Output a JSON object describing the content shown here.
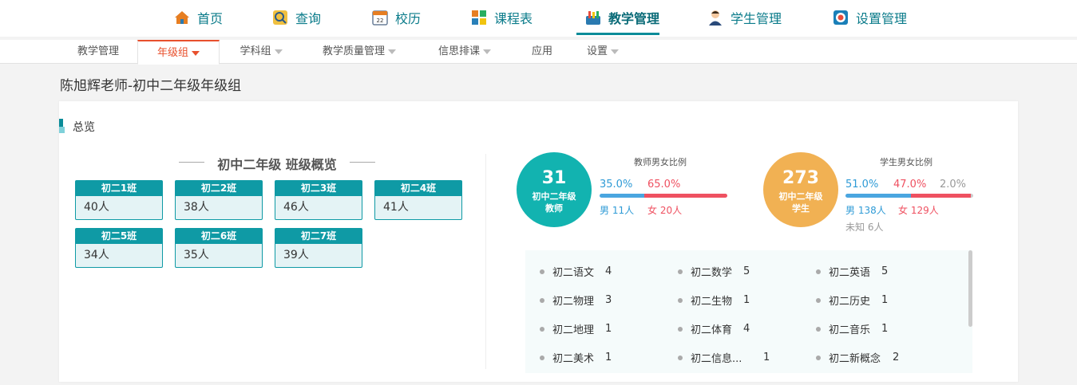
{
  "topnav": {
    "items": [
      {
        "label": "首页",
        "icon": "home-icon"
      },
      {
        "label": "查询",
        "icon": "search-icon"
      },
      {
        "label": "校历",
        "icon": "calendar-icon"
      },
      {
        "label": "课程表",
        "icon": "timetable-icon"
      },
      {
        "label": "教学管理",
        "icon": "teaching-icon",
        "active": true
      },
      {
        "label": "学生管理",
        "icon": "student-icon"
      },
      {
        "label": "设置管理",
        "icon": "settings-icon"
      }
    ]
  },
  "subnav": {
    "items": [
      {
        "label": "教学管理"
      },
      {
        "label": "年级组",
        "active": true
      },
      {
        "label": "学科组"
      },
      {
        "label": "教学质量管理"
      },
      {
        "label": "信思排课"
      },
      {
        "label": "应用"
      },
      {
        "label": "设置"
      }
    ]
  },
  "page": {
    "title": "陈旭辉老师-初中二年级年级组"
  },
  "overview": {
    "heading": "总览",
    "section_title": "初中二年级  班级概览",
    "classes": [
      {
        "name": "初二1班",
        "count": "40人"
      },
      {
        "name": "初二2班",
        "count": "38人"
      },
      {
        "name": "初二3班",
        "count": "46人"
      },
      {
        "name": "初二4班",
        "count": "41人"
      },
      {
        "name": "初二5班",
        "count": "34人"
      },
      {
        "name": "初二6班",
        "count": "35人"
      },
      {
        "name": "初二7班",
        "count": "39人"
      }
    ]
  },
  "teachers": {
    "total": "31",
    "label_line1": "初中二年级",
    "label_line2": "教师",
    "ratio_title": "教师男女比例",
    "male_pct": "35.0%",
    "female_pct": "65.0%",
    "male_count": "男 11人",
    "female_count": "女 20人",
    "male_fraction": 0.35,
    "female_fraction": 0.65
  },
  "students": {
    "total": "273",
    "label_line1": "初中二年级",
    "label_line2": "学生",
    "ratio_title": "学生男女比例",
    "male_pct": "51.0%",
    "female_pct": "47.0%",
    "unknown_pct": "2.0%",
    "male_count": "男 138人",
    "female_count": "女 129人",
    "unknown_count": "未知 6人",
    "male_fraction": 0.51,
    "female_fraction": 0.47,
    "unknown_fraction": 0.02
  },
  "subjects": [
    {
      "name": "初二语文",
      "count": "4"
    },
    {
      "name": "初二数学",
      "count": "5"
    },
    {
      "name": "初二英语",
      "count": "5"
    },
    {
      "name": "初二物理",
      "count": "3"
    },
    {
      "name": "初二生物",
      "count": "1"
    },
    {
      "name": "初二历史",
      "count": "1"
    },
    {
      "name": "初二地理",
      "count": "1"
    },
    {
      "name": "初二体育",
      "count": "4"
    },
    {
      "name": "初二音乐",
      "count": "1"
    },
    {
      "name": "初二美术",
      "count": "1"
    },
    {
      "name": "初二信息...",
      "count": "1"
    },
    {
      "name": "初二新概念",
      "count": "2"
    }
  ],
  "colors": {
    "accent": "#0a8b98",
    "active_tab": "#e8502d",
    "male": "#4aa6e0",
    "female": "#ef5161",
    "unknown": "#cccccc"
  }
}
